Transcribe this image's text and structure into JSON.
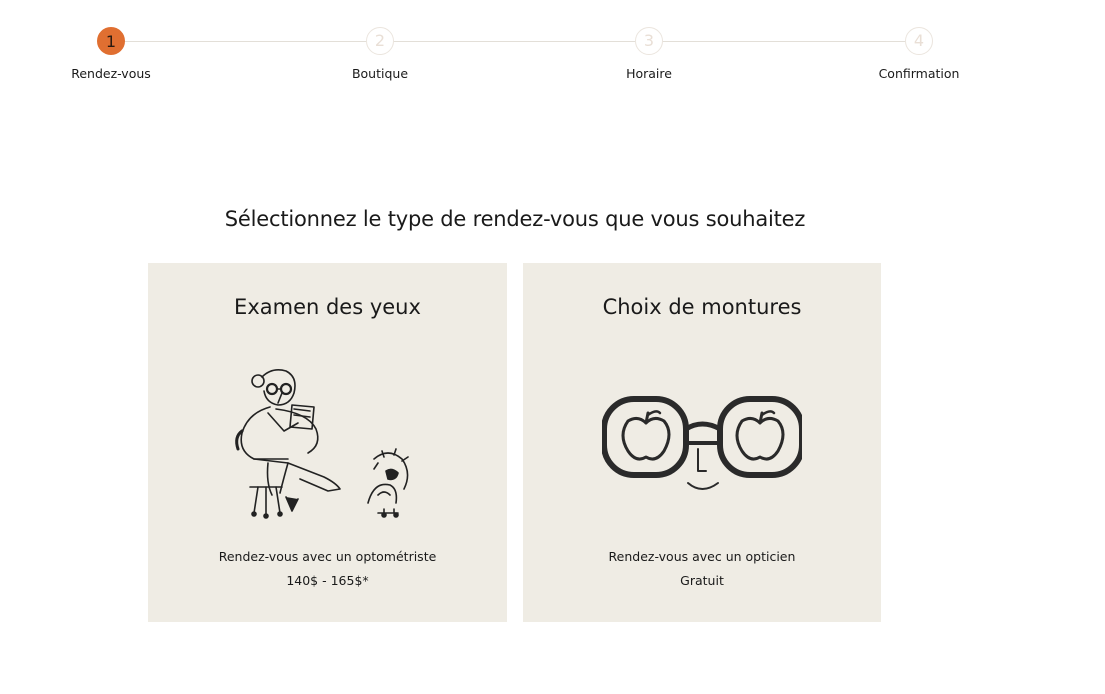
{
  "stepper": {
    "steps": [
      {
        "number": "1",
        "label": "Rendez-vous",
        "state": "active"
      },
      {
        "number": "2",
        "label": "Boutique",
        "state": "inactive"
      },
      {
        "number": "3",
        "label": "Horaire",
        "state": "inactive"
      },
      {
        "number": "4",
        "label": "Confirmation",
        "state": "inactive"
      }
    ],
    "active_color": "#e06f31",
    "inactive_color": "#ebe5de"
  },
  "heading": "Sélectionnez le type de rendez-vous que vous souhaitez",
  "cards": [
    {
      "title": "Examen des yeux",
      "illustration": "optometrist-woman-drawing",
      "description": "Rendez-vous avec un optométriste",
      "price": "140$ - 165$*"
    },
    {
      "title": "Choix de montures",
      "illustration": "apple-glasses-drawing",
      "description": "Rendez-vous avec un opticien",
      "price": "Gratuit"
    }
  ],
  "colors": {
    "card_background": "#efece4",
    "accent": "#e06f31"
  }
}
